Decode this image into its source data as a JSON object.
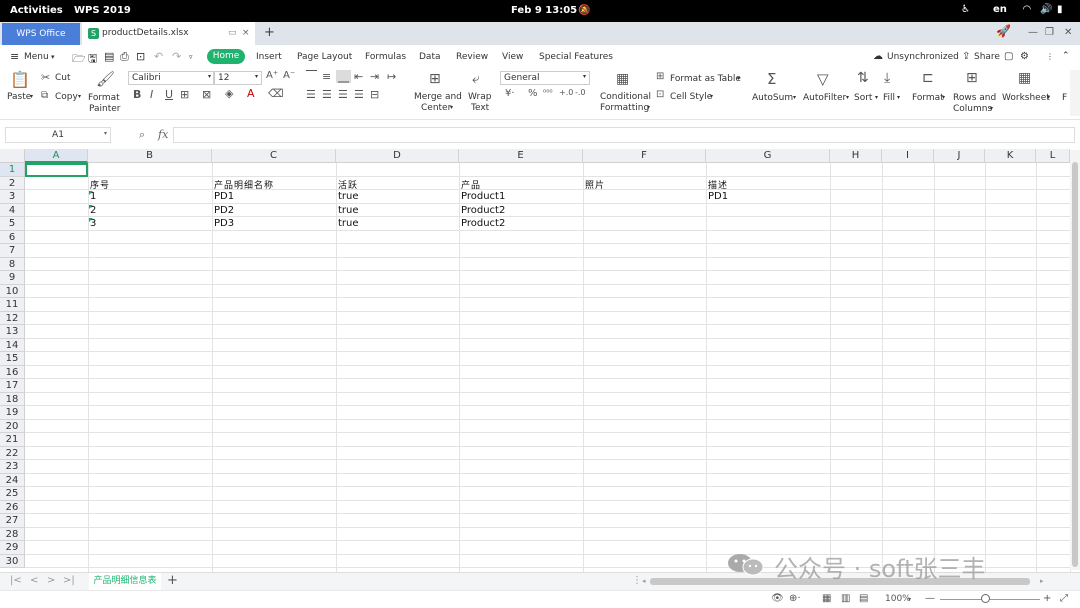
{
  "system_bar": {
    "activities": "Activities",
    "app_name": "WPS 2019",
    "clock": "Feb 9  13:05",
    "lang": "en"
  },
  "tabs": {
    "wps_office": "WPS Office",
    "file_tab": "productDetails.xlsx",
    "file_icon_letter": "S",
    "new_tab": "+"
  },
  "menu": {
    "menu_label": "Menu",
    "items": [
      "Home",
      "Insert",
      "Page Layout",
      "Formulas",
      "Data",
      "Review",
      "View",
      "Special Features"
    ],
    "unsync": "Unsynchronized",
    "share": "Share"
  },
  "ribbon": {
    "paste": "Paste",
    "cut": "Cut",
    "copy": "Copy",
    "format_painter_1": "Format",
    "format_painter_2": "Painter",
    "font_name": "Calibri",
    "font_size": "12",
    "bold": "B",
    "italic": "I",
    "underline": "U",
    "merge_1": "Merge and",
    "merge_2": "Center",
    "wrap_1": "Wrap",
    "wrap_2": "Text",
    "number_format": "General",
    "cond_1": "Conditional",
    "cond_2": "Formatting",
    "format_table": "Format as Table",
    "cell_style": "Cell Style",
    "autosum": "AutoSum",
    "autofilter": "AutoFilter",
    "sort": "Sort",
    "fill": "Fill",
    "format": "Format",
    "rows_1": "Rows and",
    "rows_2": "Columns",
    "worksheet": "Worksheet",
    "accent": "#1fb36f"
  },
  "formula_bar": {
    "cell_ref": "A1",
    "fx": "fx",
    "value": ""
  },
  "sheet": {
    "columns": [
      "A",
      "B",
      "C",
      "D",
      "E",
      "F",
      "G",
      "H",
      "I",
      "J",
      "K",
      "L"
    ],
    "rows": [
      "1",
      "2",
      "3",
      "4",
      "5",
      "6",
      "7",
      "8",
      "9",
      "10",
      "11",
      "12",
      "13",
      "14",
      "15",
      "16",
      "17",
      "18",
      "19",
      "20",
      "21",
      "22",
      "23",
      "24",
      "25",
      "26",
      "27",
      "28",
      "29",
      "30"
    ],
    "headers": {
      "b": "序号",
      "c": "产品明细名称",
      "d": "活跃",
      "e": "产品",
      "f": "照片",
      "g": "描述"
    },
    "data": [
      {
        "b": "1",
        "c": "PD1",
        "d": "true",
        "e": "Product1",
        "g": "PD1"
      },
      {
        "b": "2",
        "c": "PD2",
        "d": "true",
        "e": "Product2",
        "g": ""
      },
      {
        "b": "3",
        "c": "PD3",
        "d": "true",
        "e": "Product2",
        "g": ""
      }
    ]
  },
  "sheet_tabs": {
    "active": "产品明细信息表",
    "add": "+"
  },
  "status": {
    "zoom": "100%"
  },
  "watermark": "公众号 · soft张三丰"
}
